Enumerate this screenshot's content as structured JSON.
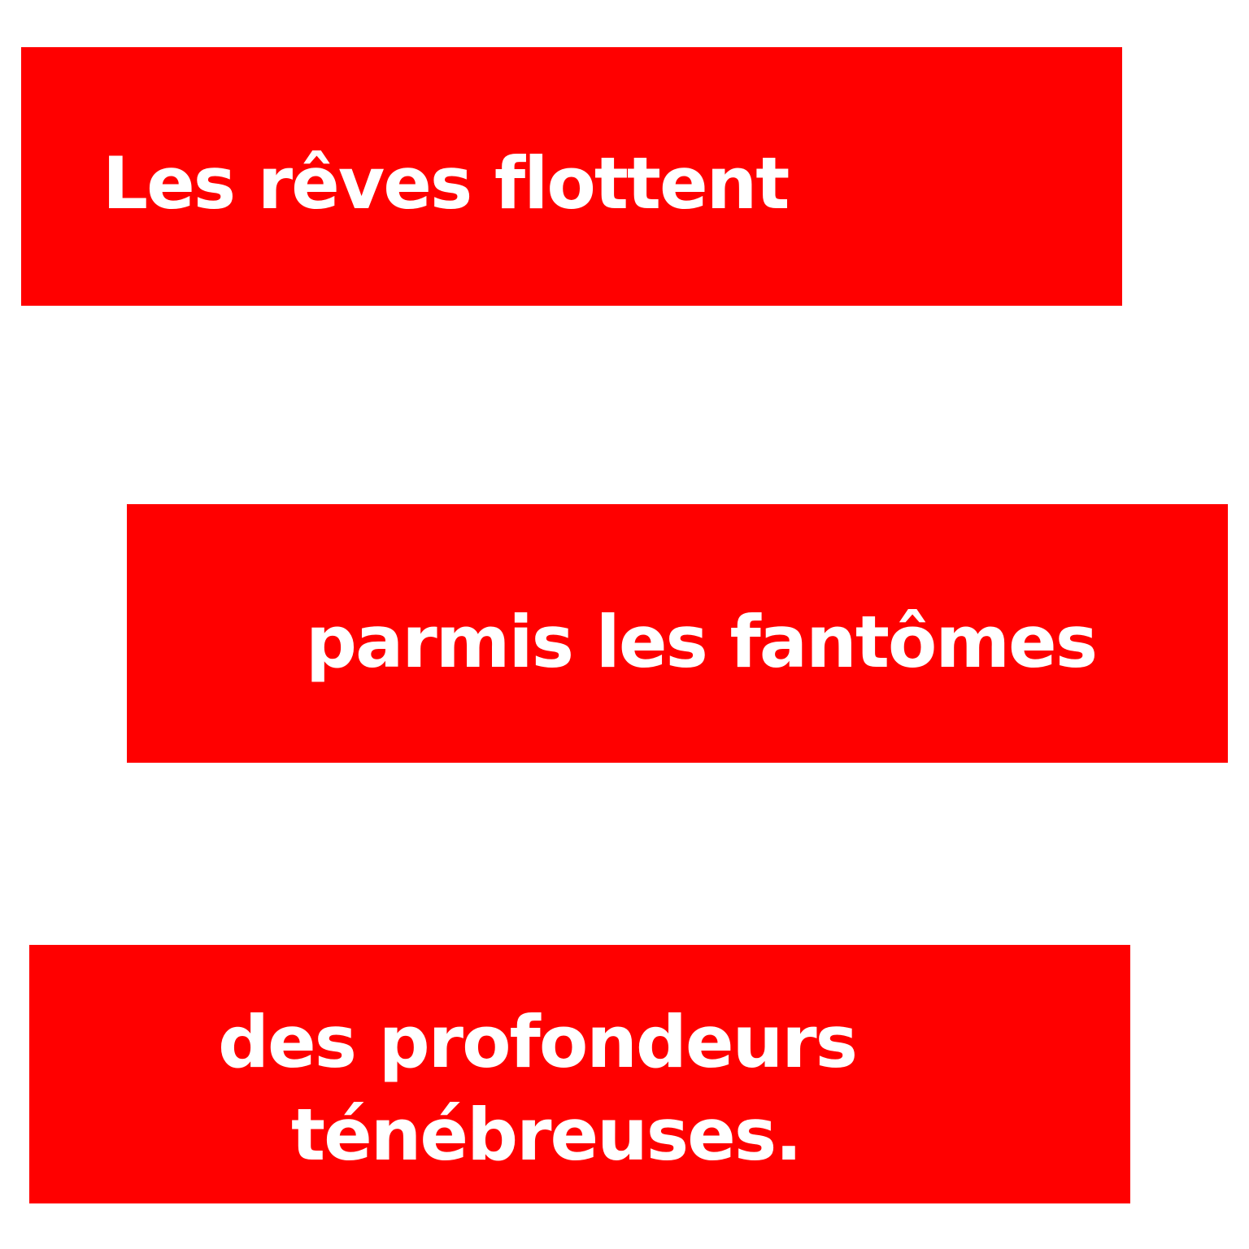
{
  "colors": {
    "banner_background": "#ff0000",
    "text": "#ffffff",
    "page_background": "#ffffff"
  },
  "banners": [
    {
      "lines": [
        "Les rêves flottent"
      ]
    },
    {
      "lines": [
        "parmis les fantômes"
      ]
    },
    {
      "lines": [
        "des profondeurs",
        "ténébreuses."
      ]
    }
  ]
}
